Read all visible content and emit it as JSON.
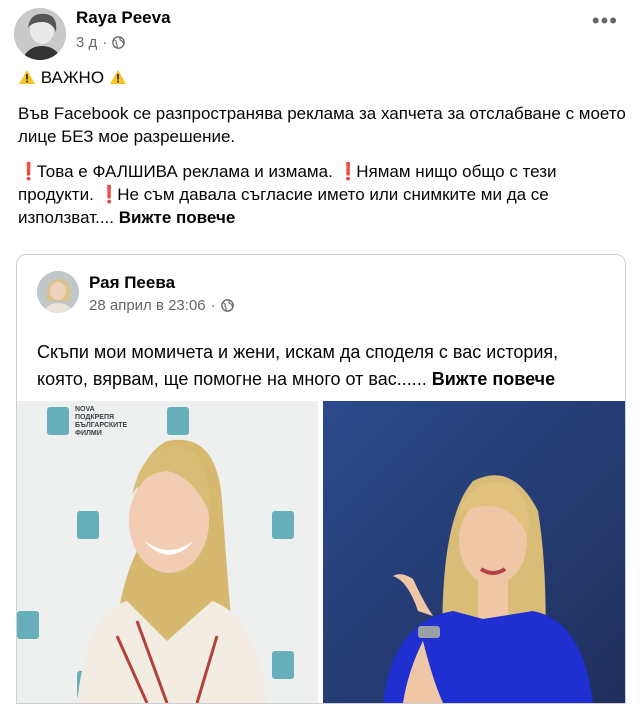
{
  "post": {
    "author": "Raya Peeva",
    "time": "3 д",
    "privacy_icon": "globe-icon",
    "more_icon": "ellipsis-icon",
    "heading": "ВАЖНО",
    "paragraph1": "Във Facebook се разпространява реклама за хапчета за отслабване с моето лице БЕЗ мое разрешение.",
    "paragraph2_part1": "Това е ФАЛШИВА реклама и измама.",
    "paragraph2_part2": "Нямам нищо общо с тези продукти.",
    "paragraph2_part3": "Не съм давала съгласие името или снимките ми да се използват....",
    "see_more": "Вижте повече"
  },
  "shared": {
    "author": "Рая Пеева",
    "time": "28 април в 23:06",
    "text": "Скъпи мои момичета и жени, искам да споделя с вас история, която, вярвам, ще помогне на много от вас......",
    "see_more": "Вижте повече",
    "backdrop_logo_line1": "NOVA",
    "backdrop_logo_line2": "ПОДКРЕПЯ",
    "backdrop_logo_line3": "БЪЛГАРСКИТЕ",
    "backdrop_logo_line4": "ФИЛМИ"
  },
  "colors": {
    "primary_text": "#050505",
    "secondary_text": "#65676b",
    "exclamation": "#e0245e",
    "warning": "#f7c325",
    "border": "#ced0d4",
    "blue_backdrop": "#2b4a8c"
  }
}
